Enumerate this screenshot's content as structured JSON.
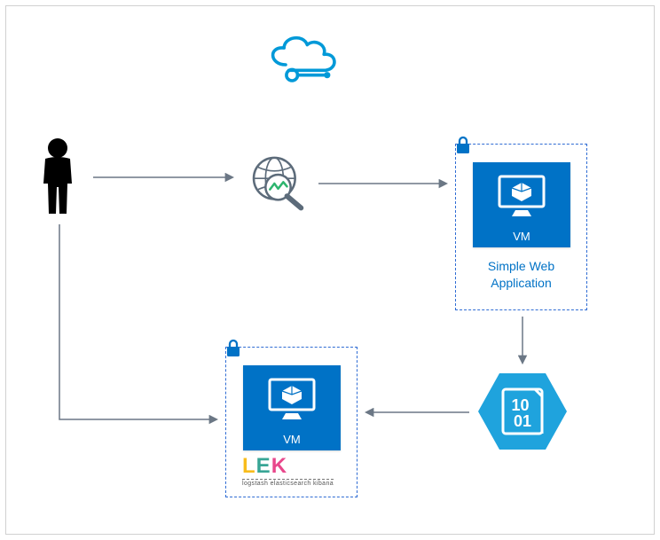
{
  "vm_label": "VM",
  "webapp_caption": "Simple Web\nApplication",
  "hex_binary": "10\n01",
  "elk": {
    "letters": [
      {
        "char": "L",
        "color": "#f8bc1c"
      },
      {
        "char": "E",
        "color": "#37a595"
      },
      {
        "char": "K",
        "color": "#e8478b"
      }
    ],
    "subtitle": "logstash elasticsearch kibana"
  },
  "icons": {
    "cloud": "azure-cloud-icon",
    "person": "user-person-icon",
    "globe": "web-analytics-icon",
    "lock": "lock-icon",
    "vm": "vm-icon",
    "data": "binary-data-hexagon-icon"
  }
}
